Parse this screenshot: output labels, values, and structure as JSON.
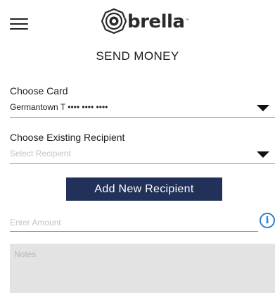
{
  "header": {
    "menu_icon": "hamburger-menu-icon",
    "logo_text": "brella",
    "logo_mark": "™",
    "logo_icon": "brella-logo-icon",
    "title": "SEND MONEY"
  },
  "card": {
    "label": "Choose Card",
    "selected_value": "Germantown T •••• •••• ••••",
    "dropdown_icon": "caret-down-icon"
  },
  "recipient": {
    "label": "Choose Existing Recipient",
    "placeholder": "Select Recipient",
    "dropdown_icon": "caret-down-icon"
  },
  "add_recipient_button": {
    "label": "Add New Recipient"
  },
  "amount": {
    "placeholder": "Enter Amount",
    "value": "",
    "info_icon": "info-icon",
    "info_glyph": "i"
  },
  "notes": {
    "placeholder": "Notes",
    "value": ""
  },
  "colors": {
    "button_bg": "#22315a",
    "button_text": "#ffffff",
    "info_accent": "#2f7fd0",
    "notes_bg": "#e3e3e3",
    "placeholder_text": "#c4c4c4"
  }
}
